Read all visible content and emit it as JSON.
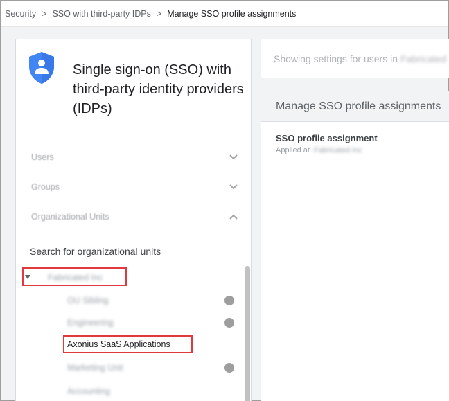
{
  "breadcrumb": {
    "items": [
      "Security",
      "SSO with third-party IDPs"
    ],
    "current": "Manage SSO profile assignments",
    "separator": ">"
  },
  "left_panel": {
    "title": "Single sign-on (SSO) with third-party identity providers (IDPs)",
    "sections": [
      {
        "label": "Users",
        "state": "collapsed"
      },
      {
        "label": "Groups",
        "state": "collapsed"
      },
      {
        "label": "Organizational Units",
        "state": "expanded"
      }
    ],
    "search_placeholder": "Search for organizational units",
    "tree": {
      "root": "Fabricated Inc",
      "children": [
        {
          "label": "OU Sibling",
          "has_dot": true
        },
        {
          "label": "Engineering",
          "has_dot": true
        },
        {
          "label": "Axonius SaaS Applications",
          "has_dot": false,
          "highlighted": true
        },
        {
          "label": "Marketing Unit",
          "has_dot": true
        },
        {
          "label": "Accounting",
          "has_dot": false
        }
      ]
    }
  },
  "right_panel": {
    "showing_prefix": "Showing settings for users in",
    "showing_org": "Fabricated",
    "card_header": "Manage SSO profile assignments",
    "assignment_label": "SSO profile assignment",
    "applied_prefix": "Applied at",
    "applied_org": "Fabricated Inc"
  },
  "colors": {
    "highlight": "#e0393e",
    "shield": "#4285f4",
    "dot": "#9e9e9e"
  },
  "icons": {
    "shield": "shield-user-icon",
    "chevron_down": "chevron-down-icon",
    "chevron_up": "chevron-up-icon",
    "caret": "caret-down-icon"
  }
}
